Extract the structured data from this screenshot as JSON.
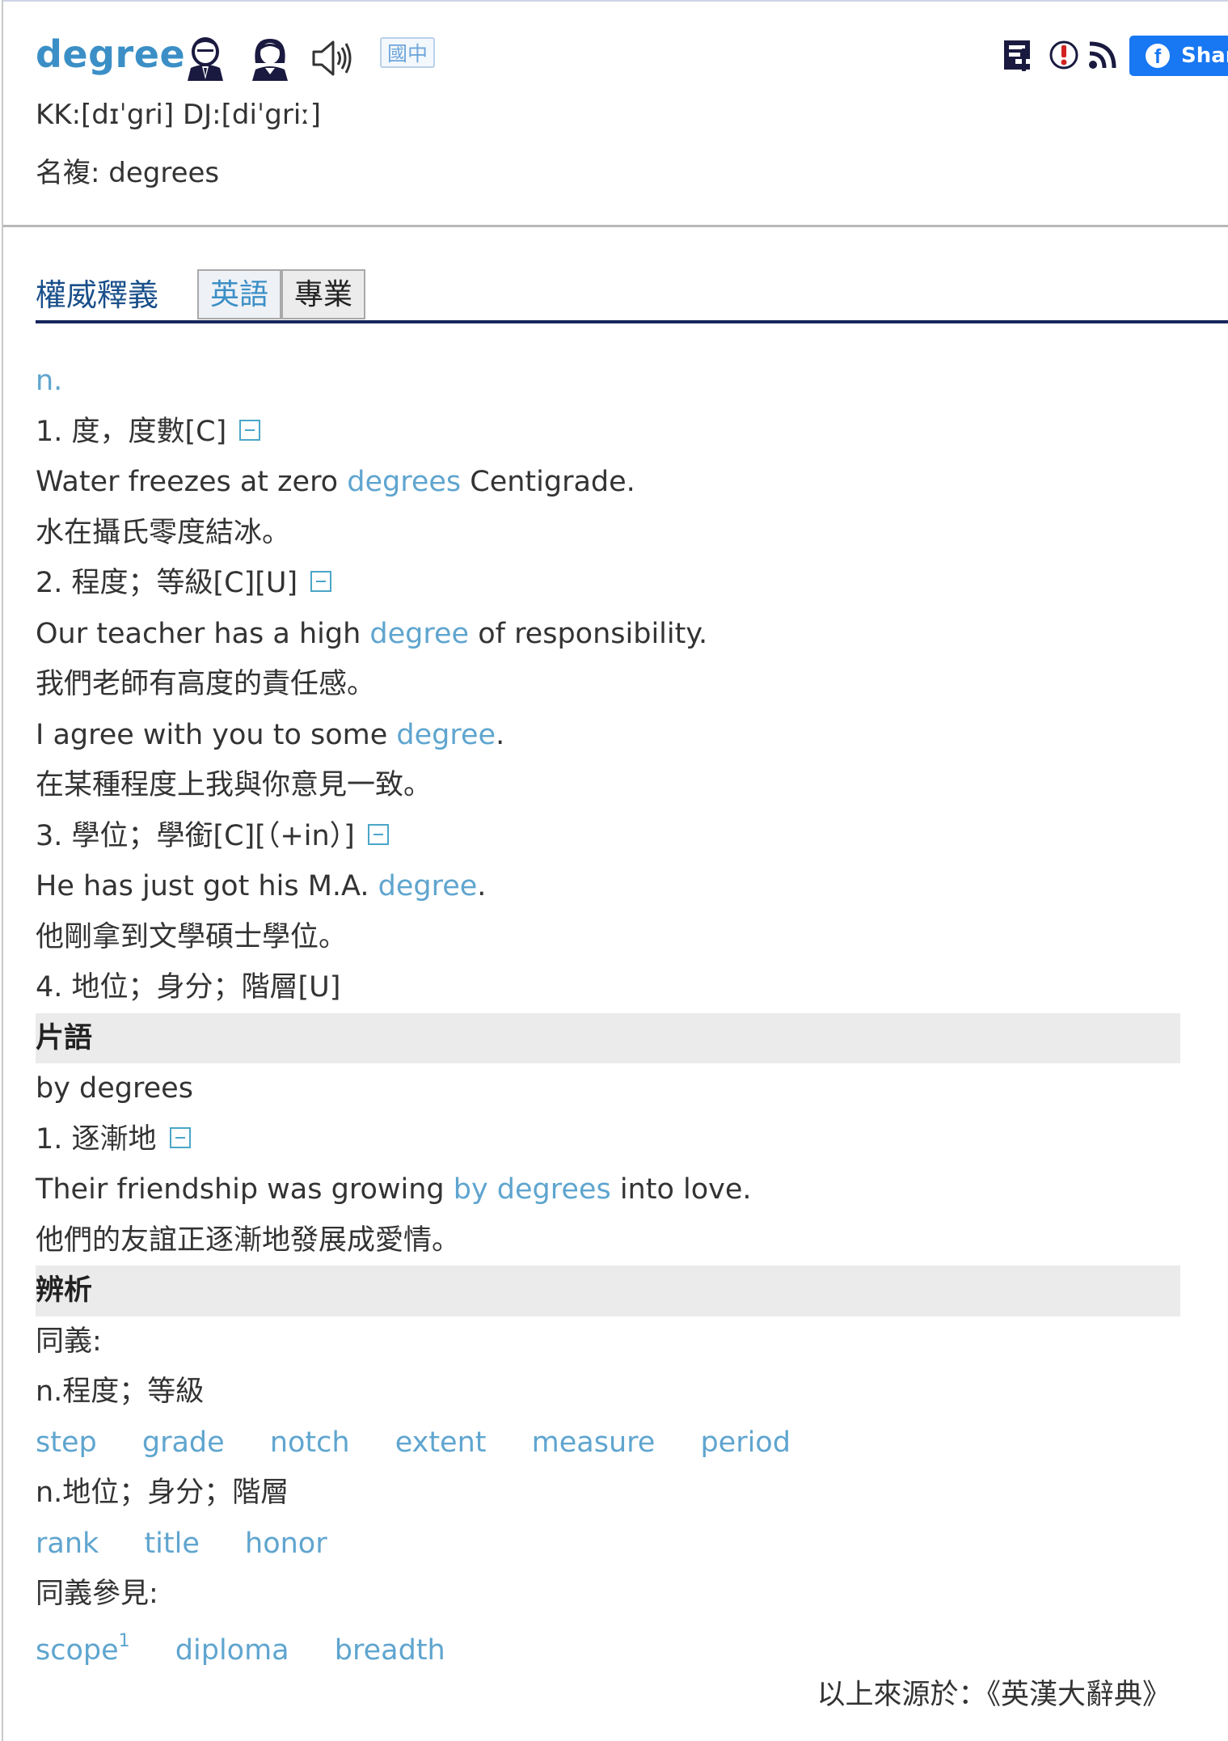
{
  "header": {
    "word": "degree",
    "pron_label": "KK:[dɪˈgri] DJ:[diˈgriː]",
    "plural_label": "名複: degrees",
    "guozhong_label": "國中",
    "share_label": "Shar",
    "icons": [
      "male-voice-icon",
      "female-voice-icon",
      "speaker-icon",
      "word-card-icon",
      "report-icon",
      "rss-icon",
      "facebook-icon"
    ]
  },
  "tabs": {
    "section_title": "權威釋義",
    "items": [
      {
        "label": "英語",
        "active": true
      },
      {
        "label": "專業",
        "active": false
      }
    ]
  },
  "entry": {
    "pos": "n.",
    "sense1": {
      "text": "1. 度，度數[C]"
    },
    "ex1": {
      "pre": "Water freezes at zero ",
      "kw": "degrees",
      "post": " Centigrade."
    },
    "ex1_zh": "水在攝氏零度結冰。",
    "sense2": {
      "text": "2. 程度；等級[C][U]"
    },
    "ex2": {
      "pre": "Our teacher has a high ",
      "kw": "degree",
      "post": " of responsibility."
    },
    "ex2_zh": "我們老師有高度的責任感。",
    "ex3": {
      "pre": "I agree with you to some ",
      "kw": "degree",
      "post": "."
    },
    "ex3_zh": "在某種程度上我與你意見一致。",
    "sense3": {
      "text": "3. 學位；學銜[C][（+in）]"
    },
    "ex4": {
      "pre": "He has just got his M.A. ",
      "kw": "degree",
      "post": "."
    },
    "ex4_zh": "他剛拿到文學碩士學位。",
    "sense4": {
      "text": "4. 地位；身分；階層[U]"
    }
  },
  "phrases": {
    "heading": "片語",
    "phrase": "by degrees",
    "sense1": "1. 逐漸地",
    "ex": {
      "pre": "Their friendship was growing ",
      "kw": "by degrees",
      "post": " into love."
    },
    "ex_zh": "他們的友誼正逐漸地發展成愛情。"
  },
  "analysis": {
    "heading": "辨析",
    "syn_label": "同義:",
    "group1_label": "n.程度；等級",
    "group1_words": [
      "step",
      "grade",
      "notch",
      "extent",
      "measure",
      "period"
    ],
    "group2_label": "n.地位；身分；階層",
    "group2_words": [
      "rank",
      "title",
      "honor"
    ],
    "see_also_label": "同義參見:",
    "see_also_words": [
      "scope",
      "diploma",
      "breadth"
    ],
    "scope_sup": "1"
  },
  "source": "以上來源於：《英漢大辭典》",
  "colors": {
    "link": "#5fa5cf",
    "word": "#3b8fc6",
    "tab_rule": "#17275c",
    "facebook": "#1877f2",
    "band": "#ebebeb"
  }
}
